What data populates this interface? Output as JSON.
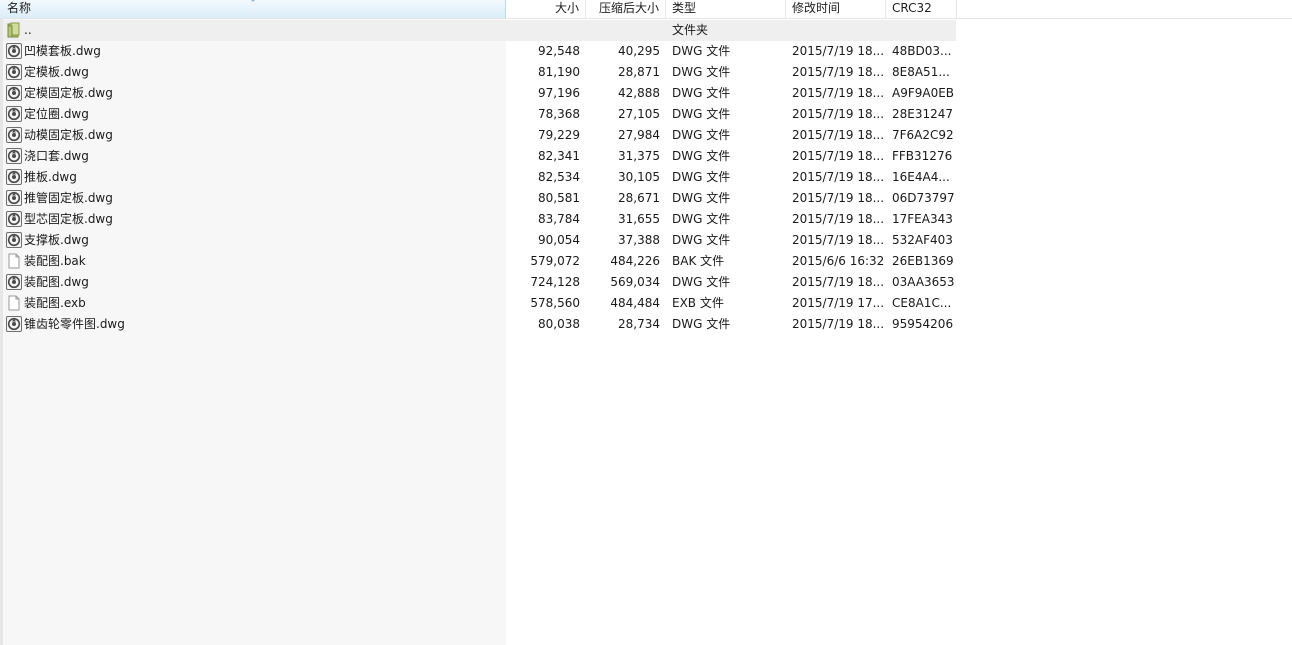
{
  "columns": {
    "name": "名称",
    "size": "大小",
    "packed": "压缩后大小",
    "type": "类型",
    "modified": "修改时间",
    "crc": "CRC32"
  },
  "rows": [
    {
      "name": "..",
      "size": "",
      "packed": "",
      "type": "文件夹",
      "modified": "",
      "crc": "",
      "icon": "folder-icon"
    },
    {
      "name": "凹模套板.dwg",
      "size": "92,548",
      "packed": "40,295",
      "type": "DWG 文件",
      "modified": "2015/7/19 18...",
      "crc": "48BD03...",
      "icon": "dwg-file-icon"
    },
    {
      "name": "定模板.dwg",
      "size": "81,190",
      "packed": "28,871",
      "type": "DWG 文件",
      "modified": "2015/7/19 18...",
      "crc": "8E8A51...",
      "icon": "dwg-file-icon"
    },
    {
      "name": "定模固定板.dwg",
      "size": "97,196",
      "packed": "42,888",
      "type": "DWG 文件",
      "modified": "2015/7/19 18...",
      "crc": "A9F9A0EB",
      "icon": "dwg-file-icon"
    },
    {
      "name": "定位圈.dwg",
      "size": "78,368",
      "packed": "27,105",
      "type": "DWG 文件",
      "modified": "2015/7/19 18...",
      "crc": "28E31247",
      "icon": "dwg-file-icon"
    },
    {
      "name": "动模固定板.dwg",
      "size": "79,229",
      "packed": "27,984",
      "type": "DWG 文件",
      "modified": "2015/7/19 18...",
      "crc": "7F6A2C92",
      "icon": "dwg-file-icon"
    },
    {
      "name": "浇口套.dwg",
      "size": "82,341",
      "packed": "31,375",
      "type": "DWG 文件",
      "modified": "2015/7/19 18...",
      "crc": "FFB31276",
      "icon": "dwg-file-icon"
    },
    {
      "name": "推板.dwg",
      "size": "82,534",
      "packed": "30,105",
      "type": "DWG 文件",
      "modified": "2015/7/19 18...",
      "crc": "16E4A4...",
      "icon": "dwg-file-icon"
    },
    {
      "name": "推管固定板.dwg",
      "size": "80,581",
      "packed": "28,671",
      "type": "DWG 文件",
      "modified": "2015/7/19 18...",
      "crc": "06D73797",
      "icon": "dwg-file-icon"
    },
    {
      "name": "型芯固定板.dwg",
      "size": "83,784",
      "packed": "31,655",
      "type": "DWG 文件",
      "modified": "2015/7/19 18...",
      "crc": "17FEA343",
      "icon": "dwg-file-icon"
    },
    {
      "name": "支撑板.dwg",
      "size": "90,054",
      "packed": "37,388",
      "type": "DWG 文件",
      "modified": "2015/7/19 18...",
      "crc": "532AF403",
      "icon": "dwg-file-icon"
    },
    {
      "name": "装配图.bak",
      "size": "579,072",
      "packed": "484,226",
      "type": "BAK 文件",
      "modified": "2015/6/6 16:32",
      "crc": "26EB1369",
      "icon": "blank-file-icon"
    },
    {
      "name": "装配图.dwg",
      "size": "724,128",
      "packed": "569,034",
      "type": "DWG 文件",
      "modified": "2015/7/19 18...",
      "crc": "03AA3653",
      "icon": "dwg-file-icon"
    },
    {
      "name": "装配图.exb",
      "size": "578,560",
      "packed": "484,484",
      "type": "EXB 文件",
      "modified": "2015/7/19 17...",
      "crc": "CE8A1C...",
      "icon": "blank-file-icon"
    },
    {
      "name": "锥齿轮零件图.dwg",
      "size": "80,038",
      "packed": "28,734",
      "type": "DWG 文件",
      "modified": "2015/7/19 18...",
      "crc": "95954206",
      "icon": "dwg-file-icon"
    }
  ]
}
